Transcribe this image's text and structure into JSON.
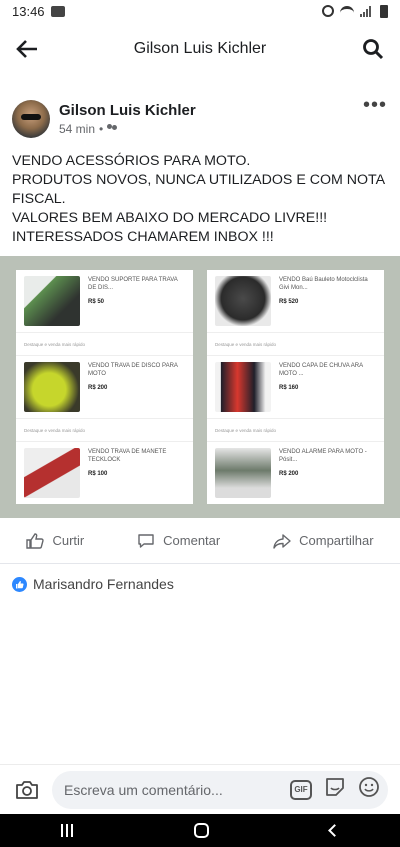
{
  "status": {
    "time": "13:46"
  },
  "header": {
    "title": "Gilson Luis Kichler"
  },
  "post": {
    "author": "Gilson Luis Kichler",
    "time": "54 min",
    "separator": "•",
    "text_lines": [
      "VENDO ACESSÓRIOS PARA MOTO.",
      "PRODUTOS NOVOS, NUNCA UTILIZADOS E COM NOTA FISCAL.",
      "VALORES BEM ABAIXO DO MERCADO LIVRE!!!",
      "INTERESSADOS CHAMAREM INBOX !!!"
    ]
  },
  "listings": {
    "left": [
      {
        "title": "VENDO SUPORTE PARA TRAVA DE DIS...",
        "price": "R$ 50",
        "thumb_color": "#5c8f4f"
      },
      {
        "title": "VENDO TRAVA DE DISCO PARA MOTO",
        "price": "R$ 200",
        "thumb_color": "#c6d62c"
      },
      {
        "title": "VENDO TRAVA DE MANETE TECKLOCK",
        "price": "R$ 100",
        "thumb_color": "#b5302f"
      }
    ],
    "right": [
      {
        "title": "VENDO Baú Bauleto Motoclclista Givi  Mon...",
        "price": "R$ 520",
        "thumb_color": "#2b2b2b"
      },
      {
        "title": "VENDO CAPA DE CHUVA ARA MOTO ...",
        "price": "R$ 160",
        "thumb_color": "#d8382e"
      },
      {
        "title": "VENDO ALARME PARA MOTO - Pósit...",
        "price": "R$ 200",
        "thumb_color": "#6d7a6b"
      }
    ],
    "separator_text": "Destaque e venda mais rápido"
  },
  "actions": {
    "like": "Curtir",
    "comment": "Comentar",
    "share": "Compartilhar"
  },
  "reactions": {
    "name": "Marisandro Fernandes"
  },
  "composer": {
    "placeholder": "Escreva um comentário...",
    "gif_label": "GIF"
  },
  "colors": {
    "like_blue": "#2d88ff",
    "media_bg": "#bac1b7"
  }
}
